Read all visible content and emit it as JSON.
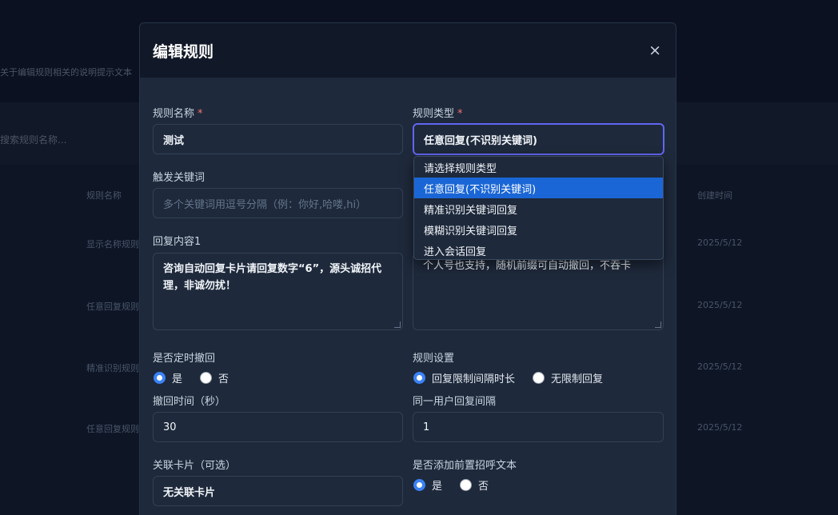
{
  "background": {
    "hint_text": "关于编辑规则相关的说明提示文本",
    "search_text": "搜索规则名称...",
    "headers": [
      "规则名称",
      "创建时间"
    ],
    "rows": [
      {
        "name": "显示名称规则",
        "date": "2025/5/12"
      },
      {
        "name": "任意回复规则",
        "date": "2025/5/12"
      },
      {
        "name": "精准识别规则",
        "date": "2025/5/12"
      },
      {
        "name": "任意回复规则",
        "date": "2025/5/12"
      }
    ]
  },
  "modal": {
    "title": "编辑规则",
    "close_label": "×",
    "rule_name": {
      "label": "规则名称",
      "required_mark": "*",
      "value": "测试"
    },
    "rule_type": {
      "label": "规则类型",
      "required_mark": "*",
      "value": "任意回复(不识别关键词)"
    },
    "trigger_keywords": {
      "label": "触发关键词",
      "placeholder": "多个关键词用逗号分隔（例：你好,哈喽,hi）"
    },
    "reply_content_1": {
      "label": "回复内容1",
      "value": "咨询自动回复卡片请回复数字“6”，源头诚招代理，非诚勿扰！"
    },
    "reply_content_2": {
      "value": "个人号也支持，随机前缀可自动撤回，不吞卡"
    },
    "auto_recall": {
      "label": "是否定时撤回",
      "options": [
        "是",
        "否"
      ],
      "selected": "是"
    },
    "rule_settings": {
      "label": "规则设置",
      "options": [
        "回复限制间隔时长",
        "无限制回复"
      ],
      "selected": "回复限制间隔时长"
    },
    "recall_time": {
      "label": "撤回时间（秒）",
      "value": "30"
    },
    "same_user_interval": {
      "label": "同一用户回复间隔",
      "value": "1"
    },
    "linked_card": {
      "label": "关联卡片（可选）",
      "value": "无关联卡片"
    },
    "greeting_prefix": {
      "label": "是否添加前置招呼文本",
      "options": [
        "是",
        "否"
      ],
      "selected": "是"
    },
    "dropdown": {
      "options": [
        "请选择规则类型",
        "任意回复(不识别关键词)",
        "精准识别关键词回复",
        "模糊识别关键词回复",
        "进入会话回复"
      ],
      "selected_index": 1
    }
  },
  "colors": {
    "accent": "#6366f1",
    "selected_option": "#1a66d6",
    "required": "#f87171",
    "radio_checked": "#3b82f6"
  }
}
